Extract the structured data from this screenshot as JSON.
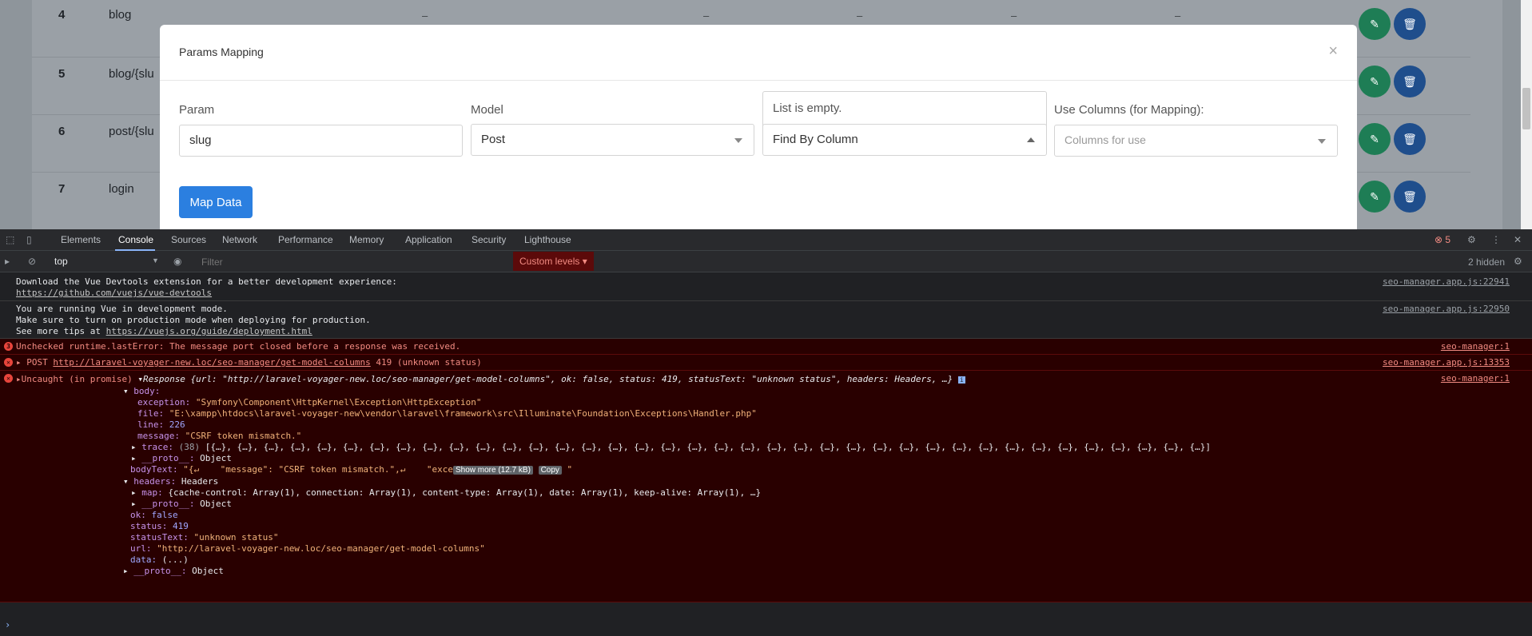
{
  "app": {
    "rows": [
      {
        "num": "4",
        "route": "blog"
      },
      {
        "num": "5",
        "route": "blog/{slu"
      },
      {
        "num": "6",
        "route": "post/{slu"
      },
      {
        "num": "7",
        "route": "login"
      }
    ],
    "dash": "–"
  },
  "modal": {
    "title": "Params Mapping",
    "close": "×",
    "param_label": "Param",
    "param_value": "slug",
    "model_label": "Model",
    "model_value": "Post",
    "empty_message": "List is empty.",
    "find_by_value": "Find By Column",
    "columns_label": "Use Columns (for Mapping):",
    "columns_placeholder": "Columns for use",
    "map_button": "Map Data"
  },
  "devtools": {
    "tabs": [
      "Elements",
      "Console",
      "Sources",
      "Network",
      "Performance",
      "Memory",
      "Application",
      "Security",
      "Lighthouse"
    ],
    "error_count": "5",
    "context": "top",
    "filter_placeholder": "Filter",
    "levels": "Custom levels ▾",
    "hidden": "2 hidden",
    "colors": {
      "background": "#202124",
      "error_bg": "#290000",
      "error_text": "#f28b82",
      "link": "#8ab4f8"
    }
  },
  "console": {
    "msg1_text": "Download the Vue Devtools extension for a better development experience:",
    "msg1_link": "https://github.com/vuejs/vue-devtools",
    "msg1_src": "seo-manager.app.js:22941",
    "msg2_line1": "You are running Vue in development mode.",
    "msg2_line2": "Make sure to turn on production mode when deploying for production.",
    "msg2_line3_prefix": "See more tips at ",
    "msg2_link": "https://vuejs.org/guide/deployment.html",
    "msg2_src": "seo-manager.app.js:22950",
    "err1_text": "Unchecked runtime.lastError: The message port closed before a response was received.",
    "err1_src": "seo-manager:1",
    "err2_prefix": "POST ",
    "err2_link": "http://laravel-voyager-new.loc/seo-manager/get-model-columns",
    "err2_suffix": " 419 (unknown status)",
    "err2_src": "seo-manager.app.js:13353",
    "err3_prefix": "Uncaught (in promise) ",
    "err3_summary": "Response {url: \"http://laravel-voyager-new.loc/seo-manager/get-model-columns\", ok: false, status: 419, statusText: \"unknown status\", headers: Headers, …}",
    "err3_src": "seo-manager:1",
    "body_key": "body:",
    "exception_k": "exception: ",
    "exception_v": "\"Symfony\\Component\\HttpKernel\\Exception\\HttpException\"",
    "file_k": "file: ",
    "file_v": "\"E:\\xampp\\htdocs\\laravel-voyager-new\\vendor\\laravel\\framework\\src\\Illuminate\\Foundation\\Exceptions\\Handler.php\"",
    "line_k": "line: ",
    "line_v": "226",
    "message_k": "message: ",
    "message_v": "\"CSRF token mismatch.\"",
    "trace_k": "trace: ",
    "trace_count": "(38) ",
    "trace_v": "[{…}, {…}, {…}, {…}, {…}, {…}, {…}, {…}, {…}, {…}, {…}, {…}, {…}, {…}, {…}, {…}, {…}, {…}, {…}, {…}, {…}, {…}, {…}, {…}, {…}, {…}, {…}, {…}, {…}, {…}, {…}, {…}, {…}, {…}, {…}, {…}, {…}, {…}]",
    "proto_k": "__proto__: ",
    "proto_v": "Object",
    "bodytext_k": "bodyText: ",
    "bodytext_v": "\"{↵    \"message\": \"CSRF token mismatch.\",↵    \"exce",
    "show_more": "Show more (12.7 kB)",
    "copy": "Copy",
    "bodytext_end": "\"",
    "headers_k": "headers: ",
    "headers_v": "Headers",
    "map_k": "map: ",
    "map_v": "{cache-control: Array(1), connection: Array(1), content-type: Array(1), date: Array(1), keep-alive: Array(1), …}",
    "ok_k": "ok: ",
    "ok_v": "false",
    "status_k": "status: ",
    "status_v": "419",
    "statustext_k": "statusText: ",
    "statustext_v": "\"unknown status\"",
    "url_k": "url: ",
    "url_v": "\"http://laravel-voyager-new.loc/seo-manager/get-model-columns\"",
    "data_k": "data: ",
    "data_v": "(...)",
    "prompt": "›"
  }
}
